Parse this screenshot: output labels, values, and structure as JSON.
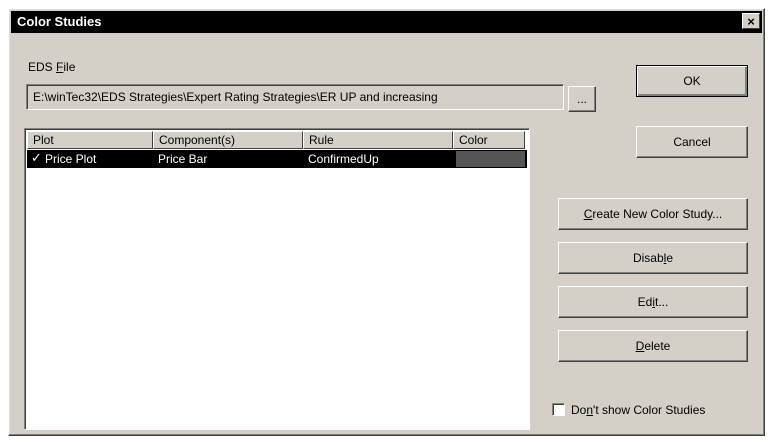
{
  "window": {
    "title": "Color Studies",
    "close_label": "×"
  },
  "eds_file": {
    "label_prefix": "EDS ",
    "label_access": "F",
    "label_suffix": "ile",
    "value": "E:\\winTec32\\EDS Strategies\\Expert Rating Strategies\\ER UP and increasing",
    "browse_label": "..."
  },
  "buttons": {
    "ok": "OK",
    "cancel": "Cancel",
    "create_access": "C",
    "create_rest": "reate New Color Study...",
    "disable_pre": "Disab",
    "disable_access": "l",
    "disable_post": "e",
    "edit_pre": "Ed",
    "edit_access": "i",
    "edit_post": "t...",
    "delete_access": "D",
    "delete_rest": "elete"
  },
  "table": {
    "columns": [
      "Plot",
      "Component(s)",
      "Rule",
      "Color"
    ],
    "rows": [
      {
        "checked": "✓",
        "plot": "Price Plot",
        "component": "Price Bar",
        "rule": "ConfirmedUp",
        "color": "#555555"
      }
    ]
  },
  "checkbox": {
    "pre": "Do",
    "access": "n",
    "post": "'t show Color Studies",
    "checked": false
  }
}
